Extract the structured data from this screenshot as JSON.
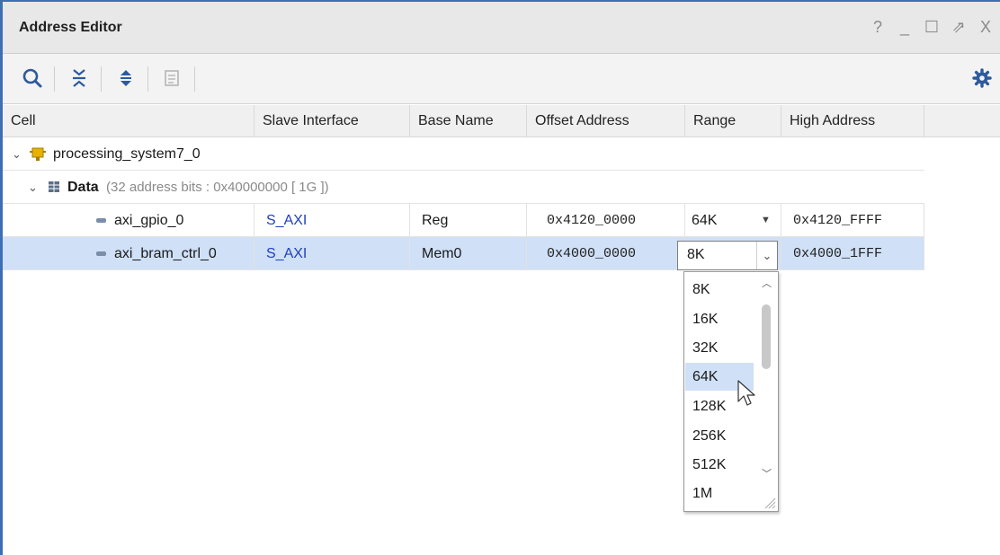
{
  "window": {
    "title": "Address Editor",
    "controls": {
      "help": "?",
      "minimize": "_",
      "maximize": "☐",
      "float": "⇗",
      "close": "X"
    }
  },
  "toolbar": {
    "icons": [
      "search-icon",
      "collapse-all-icon",
      "expand-all-icon",
      "auto-assign-icon"
    ],
    "settings_icon": "gear-icon"
  },
  "table": {
    "columns": [
      "Cell",
      "Slave Interface",
      "Base Name",
      "Offset Address",
      "Range",
      "High Address"
    ],
    "root": {
      "name": "processing_system7_0"
    },
    "group": {
      "name": "Data",
      "detail": "(32 address bits : 0x40000000 [ 1G ])"
    },
    "rows": [
      {
        "cell": "axi_gpio_0",
        "slave_interface": "S_AXI",
        "base_name": "Reg",
        "offset": "0x4120_0000",
        "range": "64K",
        "high": "0x4120_FFFF"
      },
      {
        "cell": "axi_bram_ctrl_0",
        "slave_interface": "S_AXI",
        "base_name": "Mem0",
        "offset": "0x4000_0000",
        "range": "8K",
        "high": "0x4000_1FFF"
      }
    ]
  },
  "range_dropdown": {
    "selected": "8K",
    "hovered": "64K",
    "options": [
      "8K",
      "16K",
      "32K",
      "64K",
      "128K",
      "256K",
      "512K",
      "1M"
    ]
  },
  "colors": {
    "accent": "#3d6fb6",
    "selection": "#cfe0f7",
    "link": "#1f3fbf"
  }
}
